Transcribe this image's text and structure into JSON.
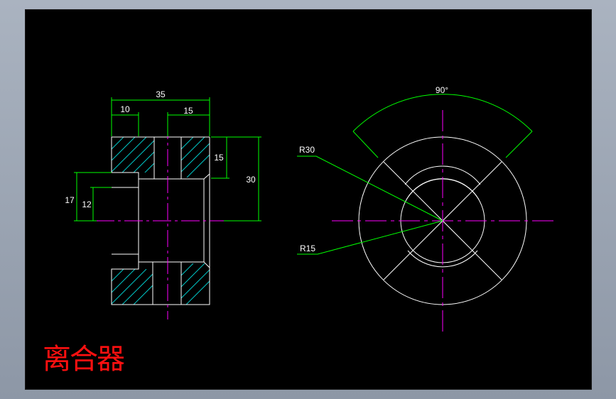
{
  "title": "离合器",
  "section_view": {
    "dimensions": {
      "overall_width": "35",
      "left_width": "10",
      "right_width": "15",
      "right_height": "15",
      "total_height": "30",
      "left_outer_height": "17",
      "left_inner_height": "12"
    }
  },
  "end_view": {
    "angle_label": "90°",
    "outer_radius_label": "R30",
    "inner_radius_label": "R15"
  },
  "colors": {
    "background": "#000000",
    "outline": "#ffffff",
    "centerline": "#ff00ff",
    "dimension": "#00ff00",
    "hatch": "#00c8c8",
    "title": "#ff1010"
  }
}
